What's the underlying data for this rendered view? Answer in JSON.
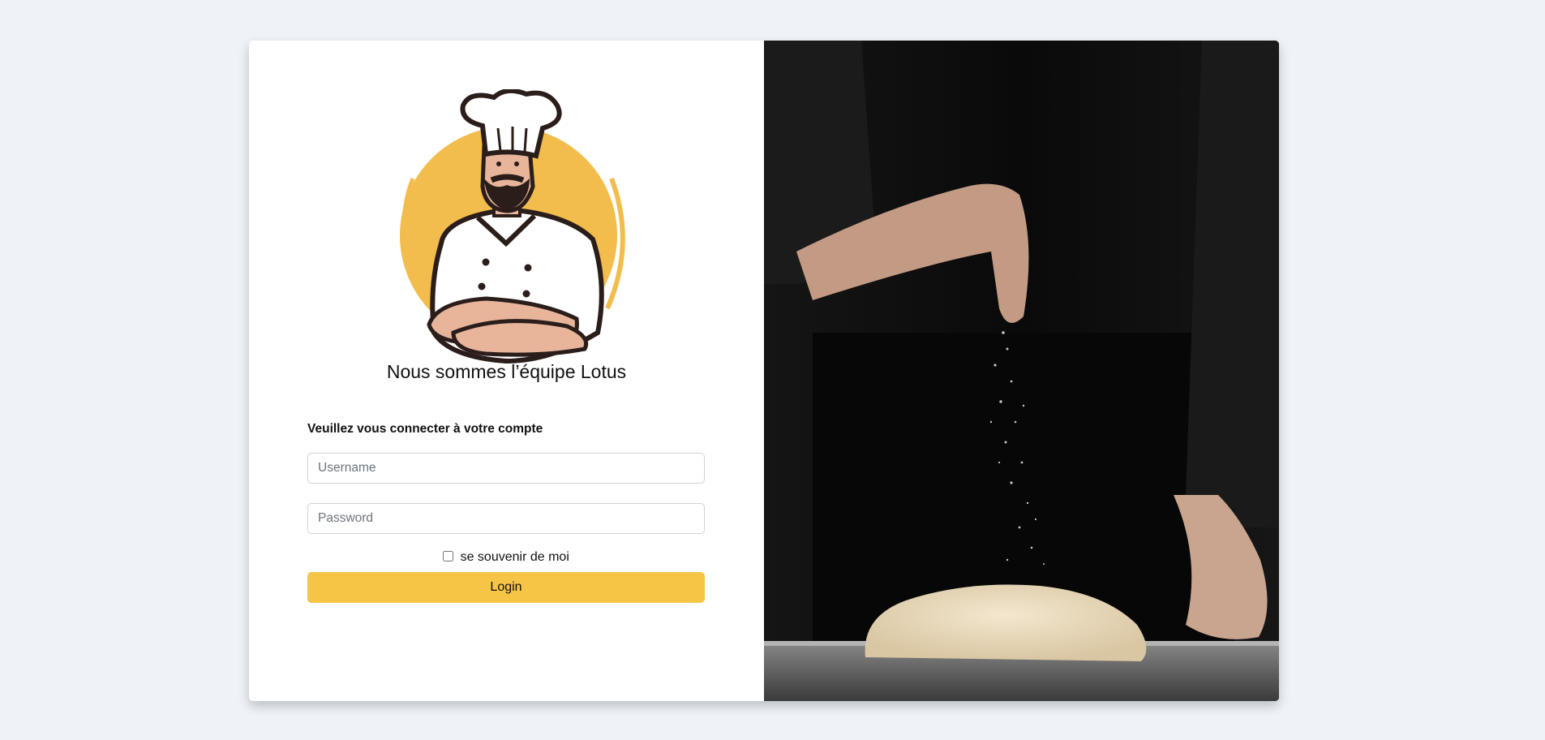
{
  "branding": {
    "logo_icon": "chef-icon",
    "team_title": "Nous sommes l’équipe Lotus"
  },
  "login": {
    "heading": "Veuillez vous connecter à votre compte",
    "username_placeholder": "Username",
    "username_value": "",
    "password_placeholder": "Password",
    "password_value": "",
    "remember_label": "se souvenir de moi",
    "remember_checked": false,
    "submit_label": "Login"
  },
  "hero_image": {
    "icon": "baker-flour-dough-photo"
  },
  "colors": {
    "page_background": "#eff3f8",
    "accent": "#f6c546",
    "logo_circle": "#f2bd4d"
  }
}
